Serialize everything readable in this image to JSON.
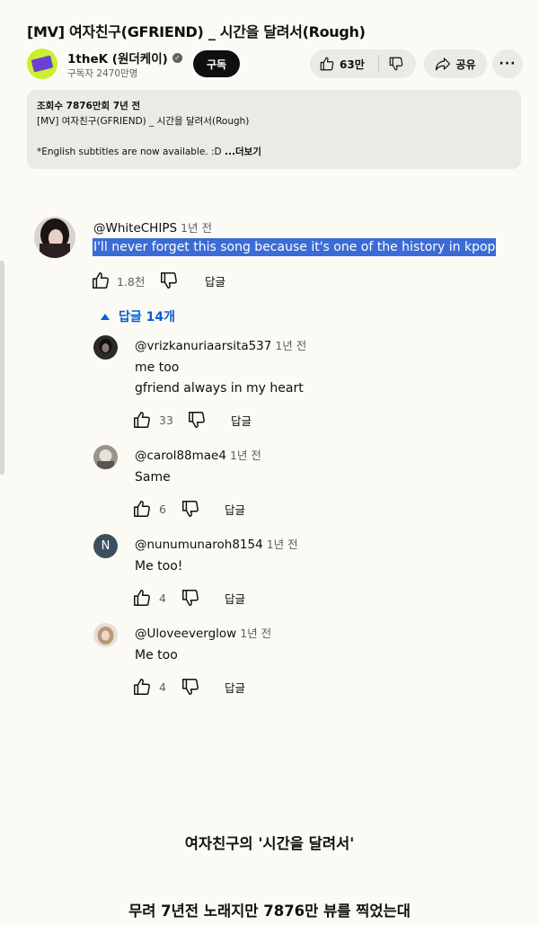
{
  "video": {
    "title": "[MV] 여자친구(GFRIEND) _ 시간을 달려서(Rough)"
  },
  "channel": {
    "name": "1theK (원더케이)",
    "subscribers": "구독자 2470만명",
    "subscribe_label": "구독",
    "avatar_color": "#c9f02a"
  },
  "actions": {
    "like_count": "63만",
    "share_label": "공유",
    "more_label": "···"
  },
  "description": {
    "stats": "조회수 7876만회  7년 전",
    "line1": "[MV] 여자친구(GFRIEND) _ 시간을 달려서(Rough)",
    "line2": "*English subtitles are now available. :D",
    "more_label": "...더보기"
  },
  "comment": {
    "author": "@WhiteCHIPS",
    "time": "1년 전",
    "text": "I'll never forget this song because it's one of the history in kpop",
    "likes": "1.8천",
    "reply_label": "답글",
    "replies_toggle": "답글 14개"
  },
  "replies": [
    {
      "author": "@vrizkanuriaarsita537",
      "time": "1년 전",
      "lines": [
        "me too",
        "gfriend always in my heart"
      ],
      "likes": "33",
      "reply_label": "답글"
    },
    {
      "author": "@carol88mae4",
      "time": "1년 전",
      "lines": [
        "Same"
      ],
      "likes": "6",
      "reply_label": "답글"
    },
    {
      "author": "@nunumunaroh8154",
      "time": "1년 전",
      "lines": [
        "Me too!"
      ],
      "likes": "4",
      "reply_label": "답글",
      "initial": "N"
    },
    {
      "author": "@Uloveeverglow",
      "time": "1년 전",
      "lines": [
        "Me too"
      ],
      "likes": "4",
      "reply_label": "답글"
    }
  ],
  "captions": {
    "line1": "여자친구의 '시간을 달려서'",
    "line2": "무려 7년전 노래지만 7876만 뷰를 찍었는대"
  },
  "colors": {
    "accent_blue": "#065fd4",
    "highlight": "#3b6bd6",
    "pill_bg": "#ebebe6"
  }
}
